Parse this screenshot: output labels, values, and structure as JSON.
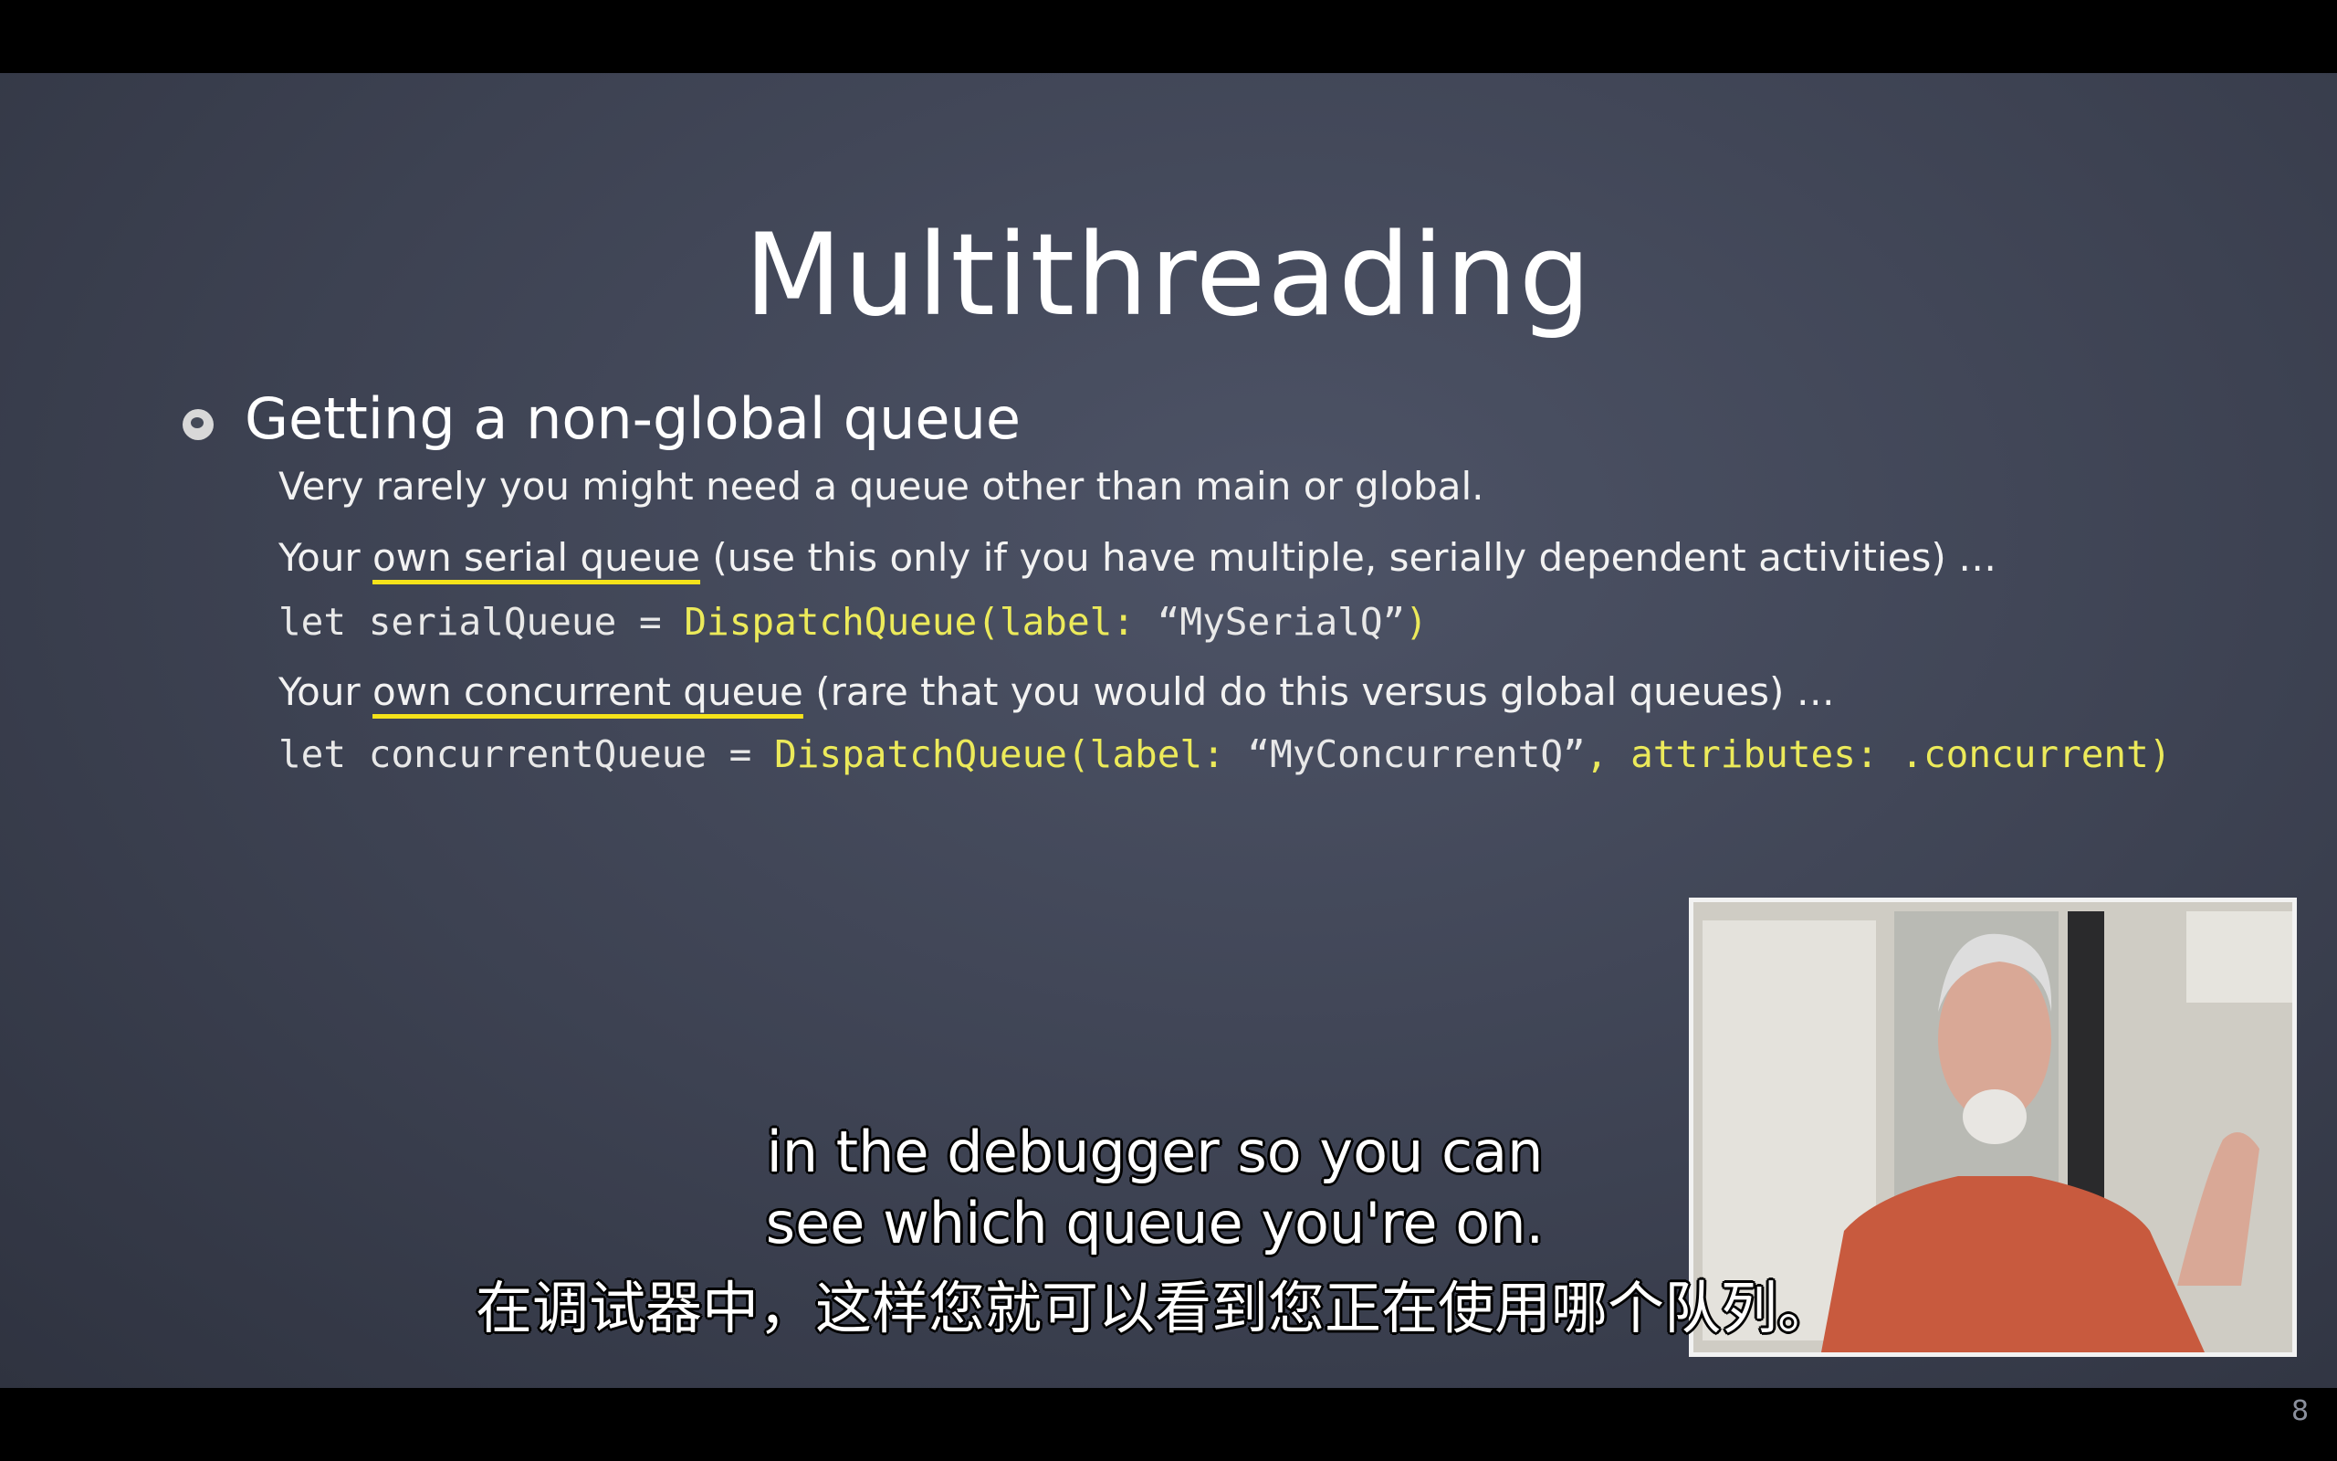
{
  "slide": {
    "title": "Multithreading",
    "heading": "Getting a non-global queue",
    "intro": "Very rarely you might need a queue other than main or global.",
    "serial": {
      "prefix": "Your ",
      "underlined": "own serial queue",
      "suffix": " (use this only if you have multiple, serially dependent activities) …",
      "code_plain": "let serialQueue = ",
      "code_highlight": "DispatchQueue(label: ",
      "code_string": "“MySerialQ”",
      "code_end": ")"
    },
    "concurrent": {
      "prefix": "Your ",
      "underlined": "own concurrent queue",
      "suffix": " (rare that you would do this versus global queues) …",
      "code_plain": "let concurrentQueue = ",
      "code_highlight": "DispatchQueue(label: ",
      "code_string": "“MyConcurrentQ”",
      "code_end": ", attributes: .concurrent)"
    },
    "page_number": "8"
  },
  "subtitles": {
    "en_line1": "in the debugger so you can",
    "en_line2": "see which queue you're on.",
    "zh": "在调试器中，这样您就可以看到您正在使用哪个队列。"
  },
  "colors": {
    "highlight": "#ecea5a",
    "underline": "#f5e31a",
    "shirt": "#c85a3e"
  }
}
